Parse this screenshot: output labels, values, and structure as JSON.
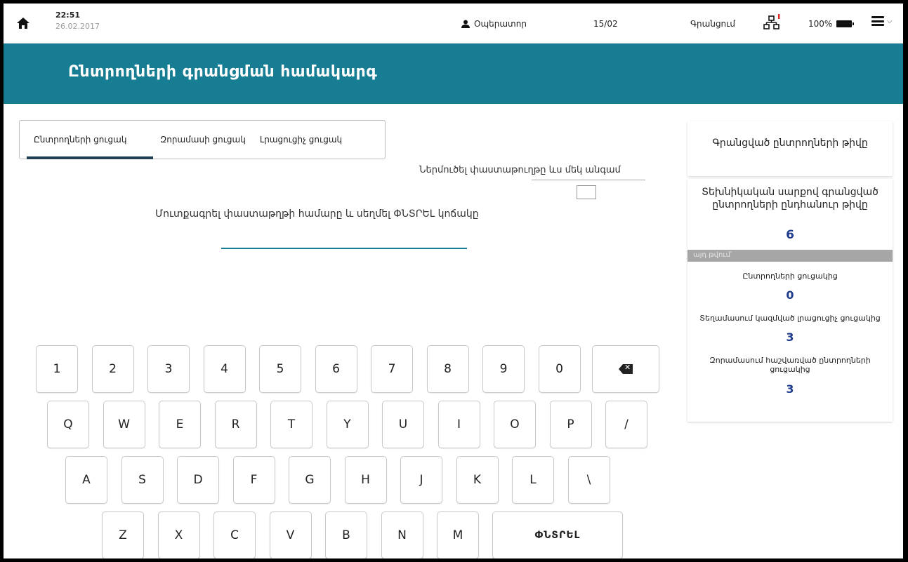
{
  "statusbar": {
    "time": "22:51",
    "date": "26.02.2017",
    "operator": "Օպերատոր",
    "page": "15/02",
    "registration": "Գրանցում",
    "battery": "100%",
    "icons": [
      "home-icon",
      "user-icon",
      "network-icon",
      "battery-icon",
      "menu-icon",
      "chevron-down-icon"
    ]
  },
  "header": {
    "title": "Ընտրողների գրանցման համակարգ"
  },
  "tabs": [
    {
      "label": "Ընտրողների ցուցակ",
      "active": true
    },
    {
      "label": "Զորամասի ցուցակ",
      "active": false
    },
    {
      "label": "Լրացուցիչ ցուցակ",
      "active": false
    }
  ],
  "confirm": {
    "label": "Ներմուծել փաստաթուղթը ևս մեկ անգամ"
  },
  "main": {
    "instruction": "Մուտքագրել փաստաթղթի համարը և սեղմել ՓՆՏՐԵԼ կոճակը",
    "doc_input_value": ""
  },
  "keyboard": {
    "row1": [
      "1",
      "2",
      "3",
      "4",
      "5",
      "6",
      "7",
      "8",
      "9",
      "0"
    ],
    "row2": [
      "Q",
      "W",
      "E",
      "R",
      "T",
      "Y",
      "U",
      "I",
      "O",
      "P",
      "/"
    ],
    "row3": [
      "A",
      "S",
      "D",
      "F",
      "G",
      "H",
      "J",
      "K",
      "L",
      "\\"
    ],
    "row4": [
      "Z",
      "X",
      "C",
      "V",
      "B",
      "N",
      "M"
    ],
    "enter_label": "ՓՆՏՐԵԼ"
  },
  "panel": {
    "title": "Գրանցված ընտրողների թիվը",
    "total_label": "Տեխնիկական սարքով գրանցված ընտրողների ընդհանուր թիվը",
    "total_value": "6",
    "including_label": "այդ թվում՝",
    "items": [
      {
        "label": "Ընտրողների ցուցակից",
        "value": "0"
      },
      {
        "label": "Տեղամասում կազմված լրացուցիչ ցուցակից",
        "value": "3"
      },
      {
        "label": "Զորամասում հաշվառված ընտրողների ցուցակից",
        "value": "3"
      }
    ]
  },
  "colors": {
    "header_bg": "#167d93",
    "value_blue": "#1f3b8e",
    "tab_underline": "#1f3f55"
  }
}
